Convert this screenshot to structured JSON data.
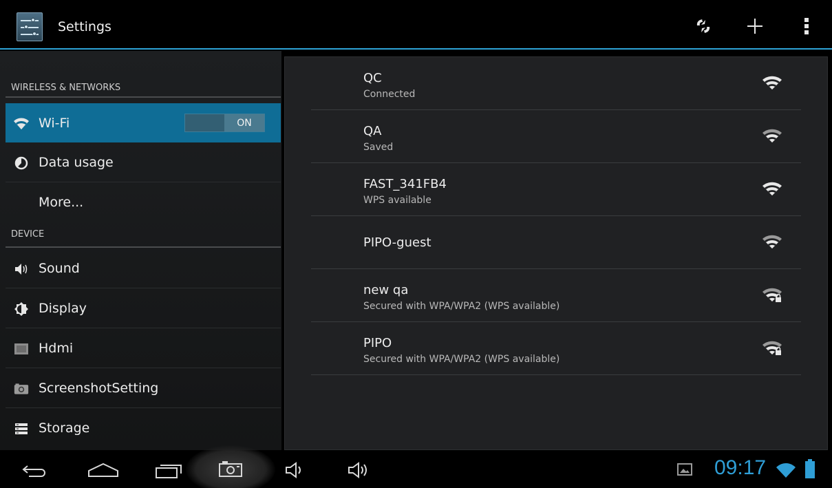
{
  "action_bar": {
    "title": "Settings"
  },
  "sidebar": {
    "sections": [
      {
        "header": "WIRELESS & NETWORKS"
      },
      {
        "header": "DEVICE"
      }
    ],
    "items": [
      {
        "label": "Wi-Fi",
        "icon": "wifi-icon",
        "toggle": "ON",
        "selected": true
      },
      {
        "label": "Data usage",
        "icon": "data-usage-icon"
      },
      {
        "label": "More..."
      },
      {
        "label": "Sound",
        "icon": "speaker-icon"
      },
      {
        "label": "Display",
        "icon": "brightness-icon"
      },
      {
        "label": "Hdmi",
        "icon": "hdmi-icon"
      },
      {
        "label": "ScreenshotSetting",
        "icon": "camera-icon"
      },
      {
        "label": "Storage",
        "icon": "storage-icon"
      }
    ]
  },
  "networks": [
    {
      "ssid": "QC",
      "status": "Connected",
      "secured": false
    },
    {
      "ssid": "QA",
      "status": "Saved",
      "secured": false
    },
    {
      "ssid": "FAST_341FB4",
      "status": "WPS available",
      "secured": false
    },
    {
      "ssid": "PIPO-guest",
      "status": "",
      "secured": false
    },
    {
      "ssid": "new qa",
      "status": "Secured with WPA/WPA2 (WPS available)",
      "secured": true
    },
    {
      "ssid": "PIPO",
      "status": "Secured with WPA/WPA2 (WPS available)",
      "secured": true
    }
  ],
  "status_bar": {
    "time": "09:17"
  },
  "colors": {
    "accent": "#2ea3d6",
    "selected_bg": "#0f6d96",
    "clock": "#2f9ed6"
  }
}
